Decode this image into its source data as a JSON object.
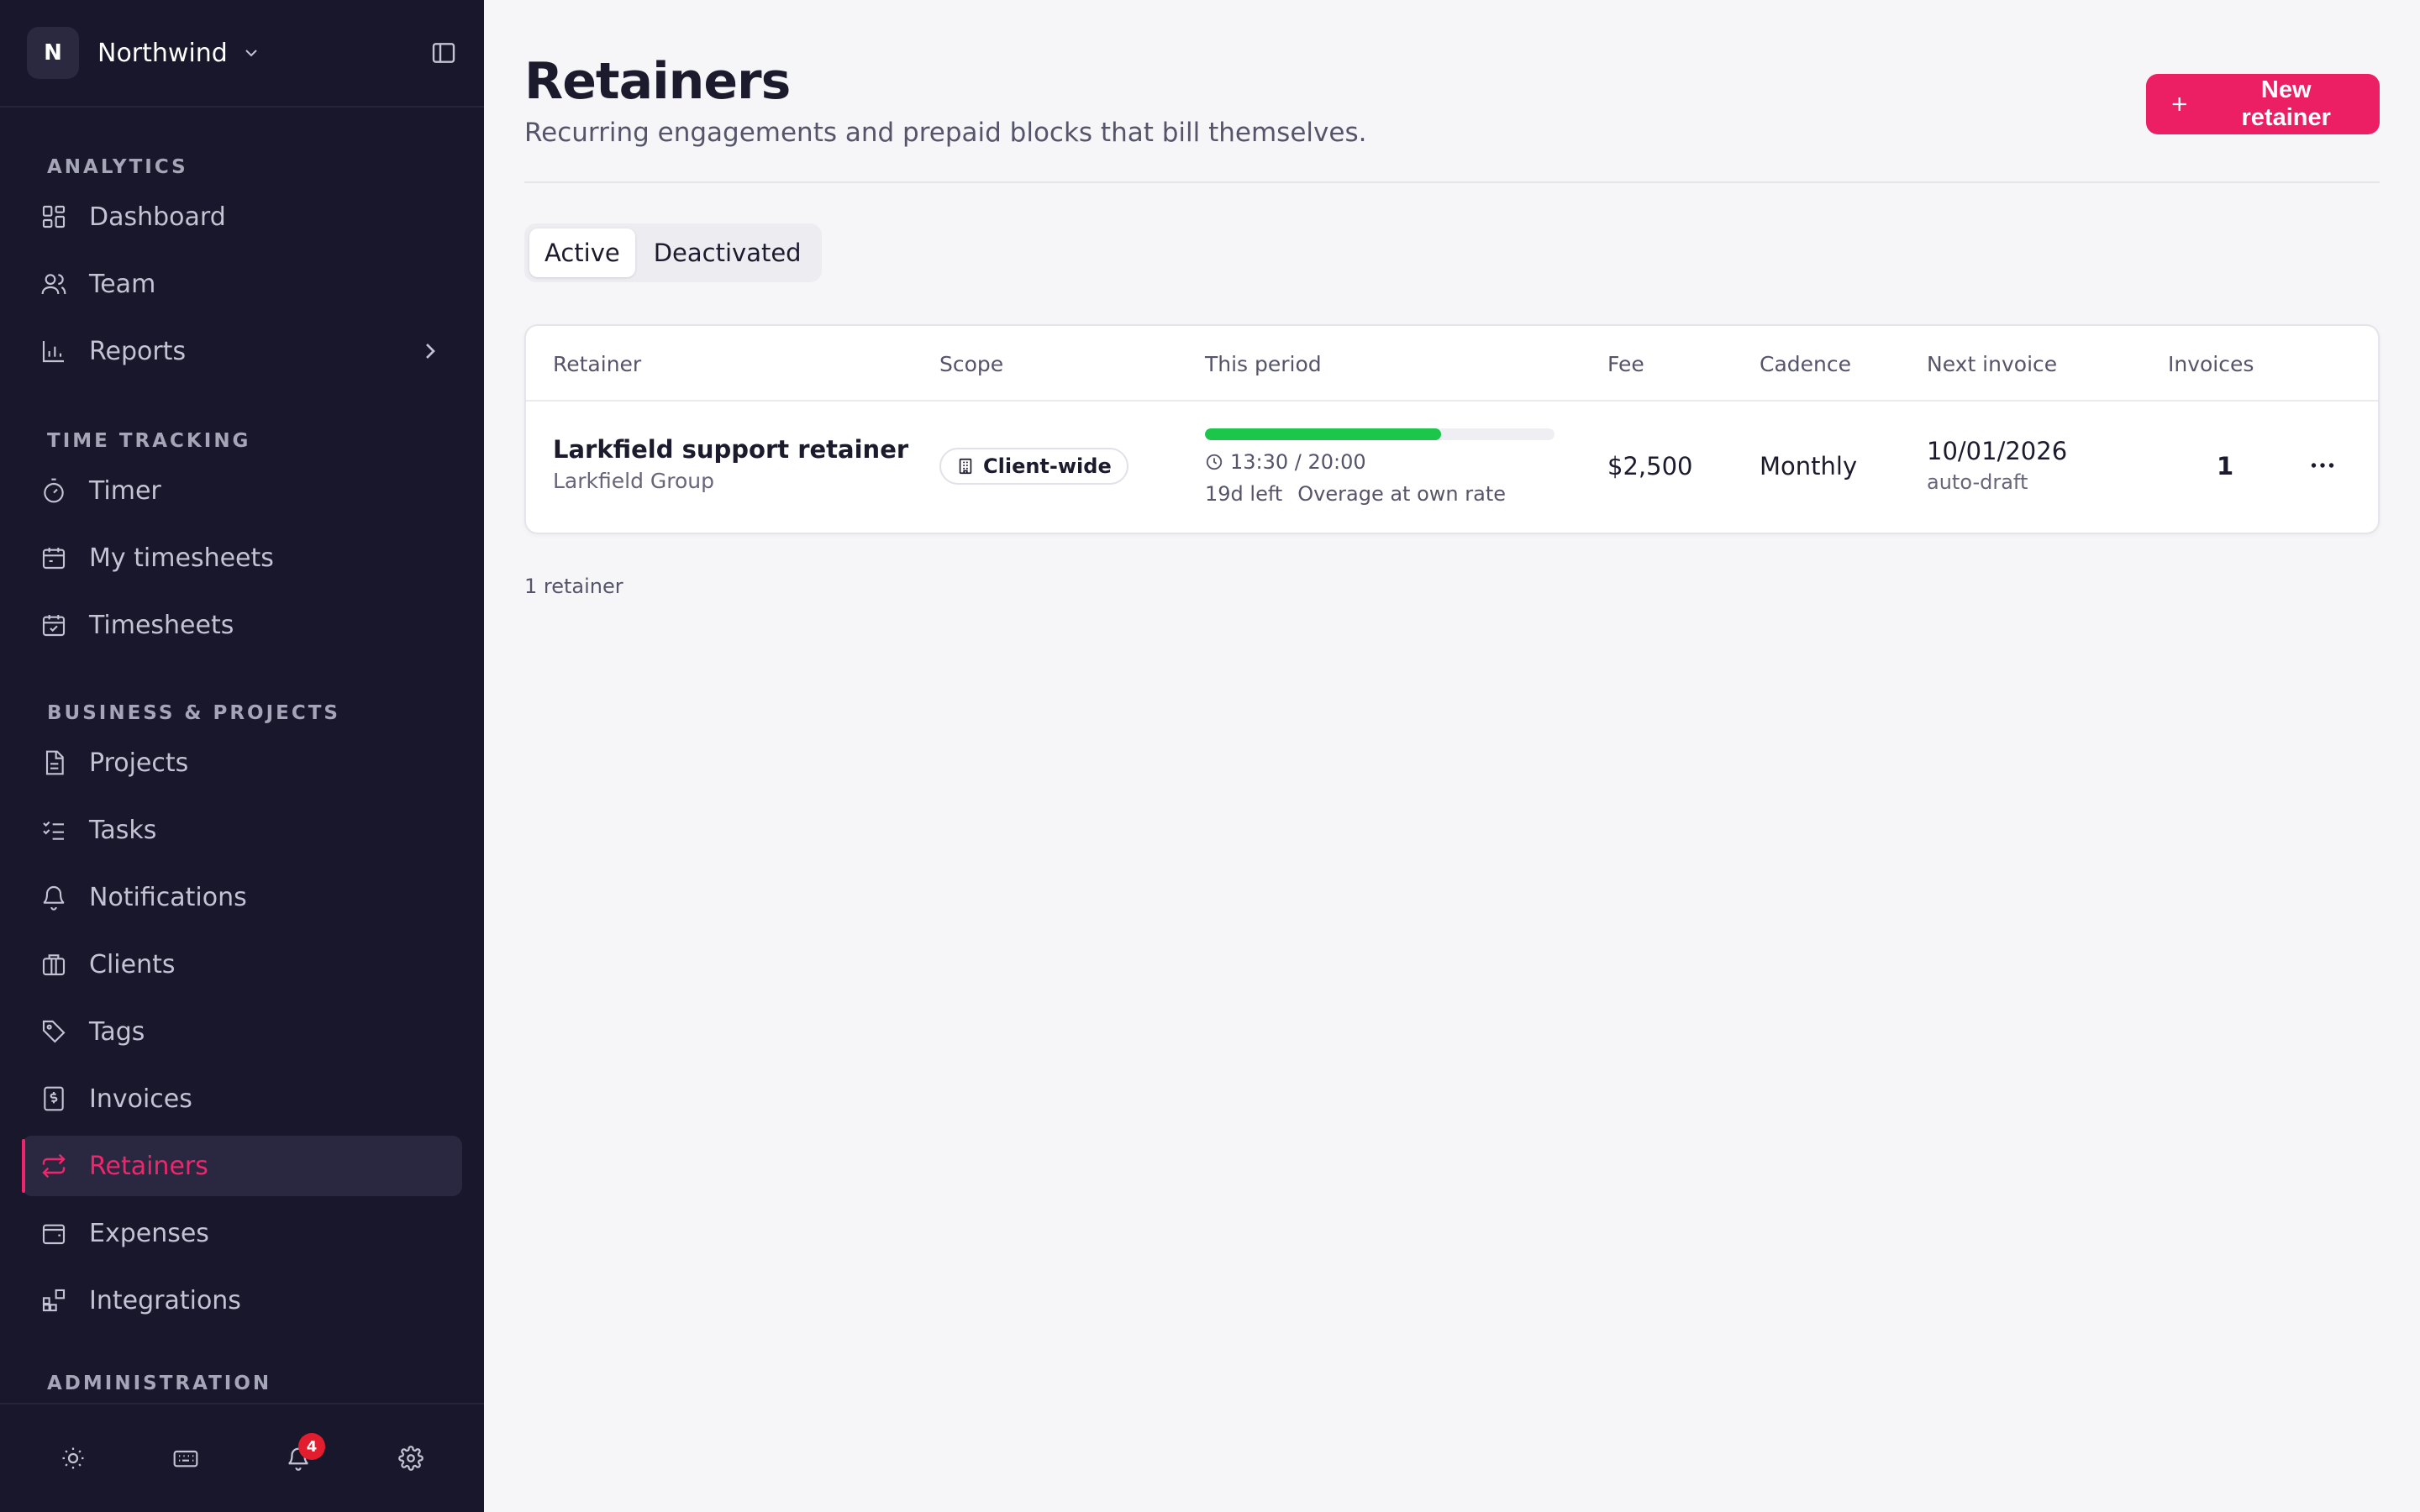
{
  "workspace": {
    "initial": "N",
    "name": "Northwind"
  },
  "sidebar": {
    "sections": [
      {
        "title": "ANALYTICS"
      },
      {
        "title": "TIME TRACKING"
      },
      {
        "title": "BUSINESS & PROJECTS"
      },
      {
        "title": "ADMINISTRATION"
      }
    ],
    "items": {
      "dashboard": "Dashboard",
      "team": "Team",
      "reports": "Reports",
      "timer": "Timer",
      "my_timesheets": "My timesheets",
      "timesheets": "Timesheets",
      "projects": "Projects",
      "tasks": "Tasks",
      "notifications": "Notifications",
      "clients": "Clients",
      "tags": "Tags",
      "invoices": "Invoices",
      "retainers": "Retainers",
      "expenses": "Expenses",
      "integrations": "Integrations"
    },
    "footer": {
      "notification_count": "4"
    }
  },
  "page": {
    "title": "Retainers",
    "subtitle": "Recurring engagements and prepaid blocks that bill themselves.",
    "new_button": "New retainer"
  },
  "tabs": {
    "active": "Active",
    "deactivated": "Deactivated"
  },
  "table": {
    "columns": {
      "retainer": "Retainer",
      "scope": "Scope",
      "period": "This period",
      "fee": "Fee",
      "cadence": "Cadence",
      "next_invoice": "Next invoice",
      "invoices": "Invoices"
    },
    "rows": [
      {
        "name": "Larkfield support retainer",
        "client": "Larkfield Group",
        "scope": "Client-wide",
        "progress_fraction": 0.675,
        "hours": "13:30 / 20:00",
        "days_left": "19d left",
        "overage": "Overage at own rate",
        "fee": "$2,500",
        "cadence": "Monthly",
        "next_invoice": "10/01/2026",
        "next_invoice_note": "auto-draft",
        "invoices": "1"
      }
    ]
  },
  "footer_count": "1 retainer",
  "colors": {
    "accent": "#ec1f64",
    "progress": "#1bc64a",
    "sidebar_bg": "#18172b"
  }
}
